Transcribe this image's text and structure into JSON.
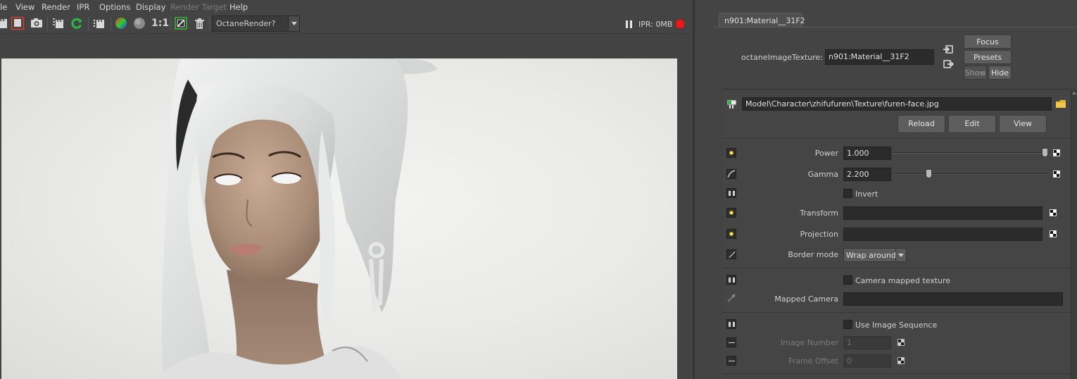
{
  "menubar": {
    "items": [
      "le",
      "View",
      "Render",
      "IPR",
      "Options",
      "Display",
      "Render Target",
      "Help"
    ]
  },
  "toolbar": {
    "ratio_label": "1:1",
    "renderer_dropdown": "OctaneRender?",
    "ipr_status": "IPR: 0MB"
  },
  "attribute_editor": {
    "tab_label": "n901:Material__31F2",
    "node_type_label": "octaneImageTexture:",
    "node_name_value": "n901:Material__31F2",
    "focus_button": "Focus",
    "presets_button": "Presets",
    "show_button": "Show",
    "hide_button": "Hide",
    "file_path": "Model\\Character\\zhifufuren\\Texture\\furen-face.jpg",
    "reload_button": "Reload",
    "edit_button": "Edit",
    "view_button": "View",
    "power": {
      "label": "Power",
      "value": "1.000",
      "slider_fraction": 1.0
    },
    "gamma": {
      "label": "Gamma",
      "value": "2.200",
      "slider_fraction": 0.22
    },
    "invert_label": "Invert",
    "transform_label": "Transform",
    "projection_label": "Projection",
    "border_mode": {
      "label": "Border mode",
      "value": "Wrap around"
    },
    "camera_mapped_label": "Camera mapped texture",
    "mapped_camera_label": "Mapped Camera",
    "use_image_sequence_label": "Use Image Sequence",
    "image_number": {
      "label": "Image Number",
      "value": "1"
    },
    "frame_offset": {
      "label": "Frame Offset",
      "value": "0"
    }
  },
  "colors": {
    "panel_bg": "#444444",
    "field_bg": "#2b2b2b",
    "record_red": "#e02020",
    "button_bg": "#5d5d5d"
  }
}
